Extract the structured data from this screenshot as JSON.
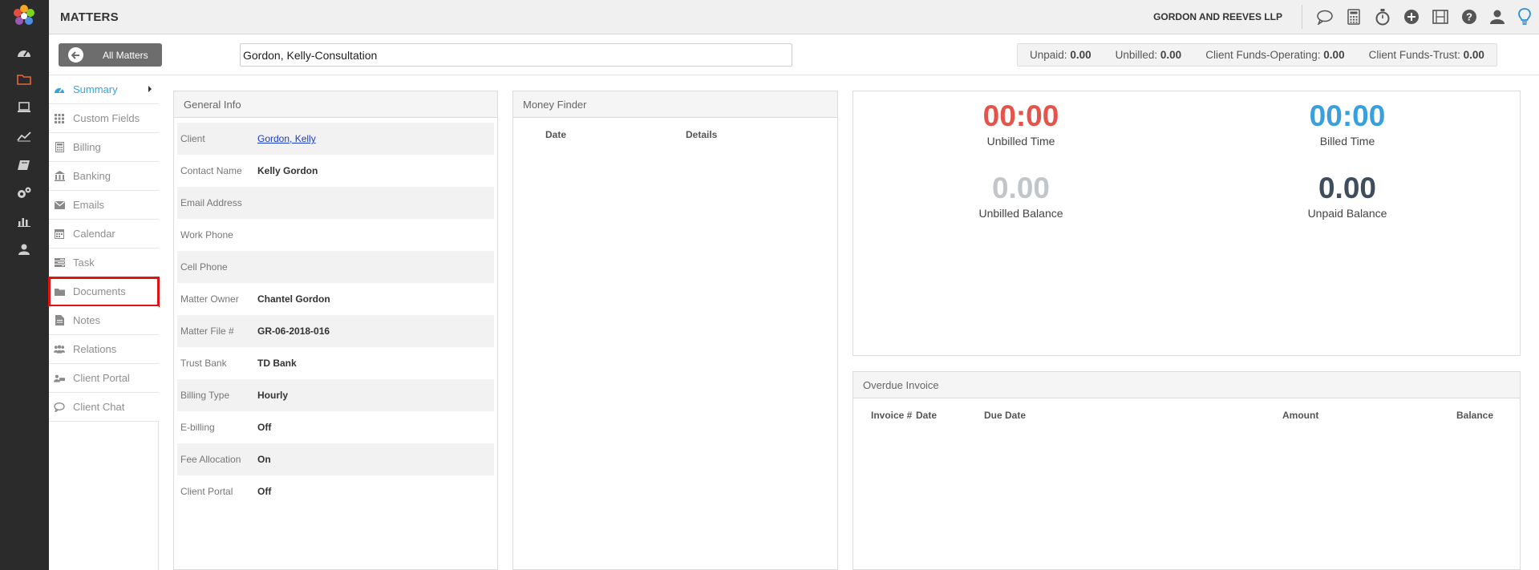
{
  "header": {
    "title": "MATTERS",
    "firm": "GORDON AND REEVES LLP",
    "icons": [
      "chat-icon",
      "calculator-icon",
      "stopwatch-icon",
      "plus-circle-icon",
      "film-icon",
      "help-icon",
      "user-icon",
      "lightbulb-icon"
    ]
  },
  "rail": {
    "icons": [
      "dashboard-icon",
      "folder-icon",
      "laptop-icon",
      "line-chart-icon",
      "book-icon",
      "cogs-icon",
      "bar-chart-icon",
      "user-icon"
    ]
  },
  "toolbar": {
    "all_matters_label": "All Matters",
    "matter_name": "Gordon, Kelly-Consultation",
    "totals": {
      "unpaid_label": "Unpaid:",
      "unpaid_value": "0.00",
      "unbilled_label": "Unbilled:",
      "unbilled_value": "0.00",
      "cfo_label": "Client Funds-Operating:",
      "cfo_value": "0.00",
      "cft_label": "Client Funds-Trust:",
      "cft_value": "0.00"
    }
  },
  "menu": {
    "items": [
      {
        "label": "Summary",
        "icon": "dashboard-icon"
      },
      {
        "label": "Custom Fields",
        "icon": "grid-icon"
      },
      {
        "label": "Billing",
        "icon": "calculator-icon"
      },
      {
        "label": "Banking",
        "icon": "bank-icon"
      },
      {
        "label": "Emails",
        "icon": "envelope-icon"
      },
      {
        "label": "Calendar",
        "icon": "calendar-icon"
      },
      {
        "label": "Task",
        "icon": "tasks-icon"
      },
      {
        "label": "Documents",
        "icon": "folder-icon"
      },
      {
        "label": "Notes",
        "icon": "note-icon"
      },
      {
        "label": "Relations",
        "icon": "users-icon"
      },
      {
        "label": "Client Portal",
        "icon": "portal-icon"
      },
      {
        "label": "Client Chat",
        "icon": "chat-icon"
      }
    ]
  },
  "general_info": {
    "title": "General Info",
    "rows": [
      {
        "label": "Client",
        "value": "Gordon, Kelly"
      },
      {
        "label": "Contact Name",
        "value": "Kelly Gordon"
      },
      {
        "label": "Email Address",
        "value": ""
      },
      {
        "label": "Work Phone",
        "value": ""
      },
      {
        "label": "Cell Phone",
        "value": ""
      },
      {
        "label": "Matter Owner",
        "value": "Chantel Gordon"
      },
      {
        "label": "Matter File #",
        "value": "GR-06-2018-016"
      },
      {
        "label": "Trust Bank",
        "value": "TD Bank"
      },
      {
        "label": "Billing Type",
        "value": "Hourly"
      },
      {
        "label": "E-billing",
        "value": "Off"
      },
      {
        "label": "Fee Allocation",
        "value": "On"
      },
      {
        "label": "Client Portal",
        "value": "Off"
      }
    ]
  },
  "money_finder": {
    "title": "Money Finder",
    "columns": [
      "Date",
      "Details"
    ]
  },
  "stats": {
    "unbilled_time": {
      "value": "00:00",
      "label": "Unbilled Time",
      "color": "#e5534b"
    },
    "billed_time": {
      "value": "00:00",
      "label": "Billed Time",
      "color": "#3aa0dd"
    },
    "unbilled_balance": {
      "value": "0.00",
      "label": "Unbilled Balance",
      "color": "#c2c5c9"
    },
    "unpaid_balance": {
      "value": "0.00",
      "label": "Unpaid Balance",
      "color": "#3f4e5c"
    }
  },
  "overdue_invoice": {
    "title": "Overdue Invoice",
    "columns": [
      "Invoice #",
      "Date",
      "Due Date",
      "Amount",
      "Balance"
    ]
  },
  "colors": {
    "accent": "#35a4dc",
    "rail": "#2b2b2b",
    "highlight": "#e01313"
  }
}
